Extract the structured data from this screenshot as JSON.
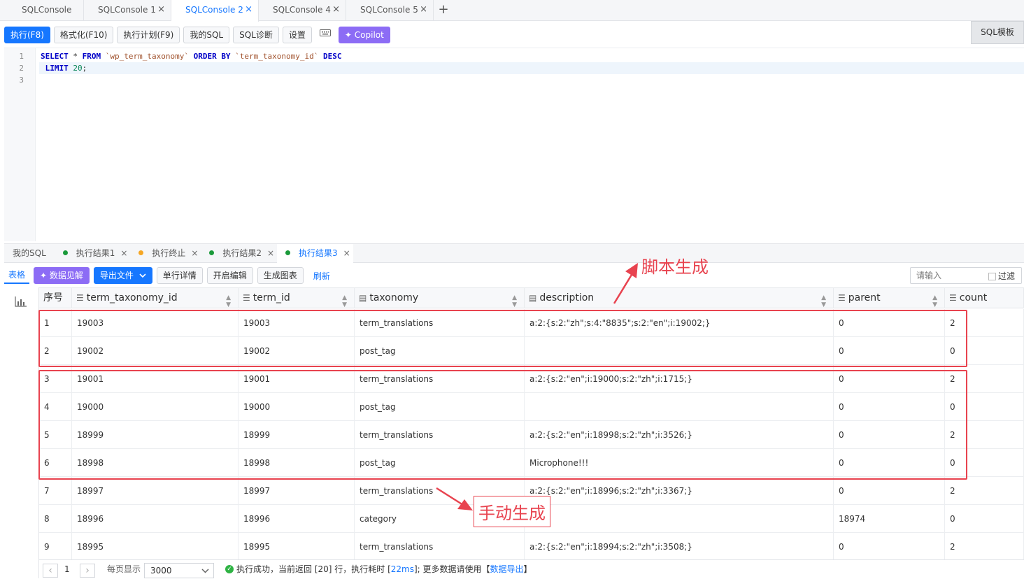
{
  "tabs": [
    {
      "label": "SQLConsole",
      "closable": false,
      "active": false
    },
    {
      "label": "SQLConsole 1",
      "closable": true,
      "active": false
    },
    {
      "label": "SQLConsole 2",
      "closable": true,
      "active": true
    },
    {
      "label": "SQLConsole 4",
      "closable": true,
      "active": false
    },
    {
      "label": "SQLConsole 5",
      "closable": true,
      "active": false
    }
  ],
  "toolbar": {
    "execute": "执行(F8)",
    "format": "格式化(F10)",
    "plan": "执行计划(F9)",
    "my_sql": "我的SQL",
    "diagnose": "SQL诊断",
    "settings": "设置",
    "keyboard_icon": "keyboard-icon",
    "copilot": "Copilot",
    "sql_template": "SQL模板"
  },
  "editor": {
    "line_numbers": [
      "1",
      "2",
      "3"
    ],
    "line1": {
      "kw1": "SELECT",
      "star": " * ",
      "kw2": "FROM",
      "table": " `wp_term_taxonomy` ",
      "kw3": "ORDER BY",
      "col": " `term_taxonomy_id` ",
      "kw4": "DESC"
    },
    "line2": {
      "kw": " LIMIT",
      "num": " 20",
      "semi": ";"
    }
  },
  "result_tabs": [
    {
      "label": "我的SQL",
      "dot": "",
      "closable": false,
      "active": false
    },
    {
      "label": "执行结果1",
      "dot": "#1a9a3a",
      "closable": true,
      "active": false
    },
    {
      "label": "执行终止",
      "dot": "#f5a623",
      "closable": true,
      "active": false
    },
    {
      "label": "执行结果2",
      "dot": "#1a9a3a",
      "closable": true,
      "active": false
    },
    {
      "label": "执行结果3",
      "dot": "#1a9a3a",
      "closable": true,
      "active": true
    }
  ],
  "result_toolbar": {
    "table": "表格",
    "insight": "数据见解",
    "export": "导出文件",
    "row_detail": "单行详情",
    "edit": "开启编辑",
    "gen_chart": "生成图表",
    "refresh": "刷新",
    "search_placeholder": "请输入",
    "filter": "过滤"
  },
  "grid": {
    "headers": [
      "序号",
      "term_taxonomy_id",
      "term_id",
      "taxonomy",
      "description",
      "parent",
      "count"
    ],
    "rows": [
      [
        "1",
        "19003",
        "19003",
        "term_translations",
        "a:2:{s:2:\"zh\";s:4:\"8835\";s:2:\"en\";i:19002;}",
        "0",
        "2"
      ],
      [
        "2",
        "19002",
        "19002",
        "post_tag",
        "",
        "0",
        "0"
      ],
      [
        "3",
        "19001",
        "19001",
        "term_translations",
        "a:2:{s:2:\"en\";i:19000;s:2:\"zh\";i:1715;}",
        "0",
        "2"
      ],
      [
        "4",
        "19000",
        "19000",
        "post_tag",
        "",
        "0",
        "0"
      ],
      [
        "5",
        "18999",
        "18999",
        "term_translations",
        "a:2:{s:2:\"en\";i:18998;s:2:\"zh\";i:3526;}",
        "0",
        "2"
      ],
      [
        "6",
        "18998",
        "18998",
        "post_tag",
        "Microphone!!!",
        "0",
        "0"
      ],
      [
        "7",
        "18997",
        "18997",
        "term_translations",
        "a:2:{s:2:\"en\";i:18996;s:2:\"zh\";i:3367;}",
        "0",
        "2"
      ],
      [
        "8",
        "18996",
        "18996",
        "category",
        "",
        "18974",
        "0"
      ],
      [
        "9",
        "18995",
        "18995",
        "term_translations",
        "a:2:{s:2:\"en\";i:18994;s:2:\"zh\";i:3508;}",
        "0",
        "2"
      ]
    ]
  },
  "footer": {
    "page": "1",
    "per_page_label": "每页显示",
    "per_page_value": "3000",
    "status_prefix": "执行成功，当前返回 [20] 行，执行耗时 [",
    "elapsed": "22ms",
    "status_mid": "]; 更多数据请使用【",
    "export_link": "数据导出",
    "status_suffix": "】"
  },
  "annotations": {
    "script_generated": "脚本生成",
    "manually_generated": "手动生成",
    "color": "#e8434f"
  }
}
